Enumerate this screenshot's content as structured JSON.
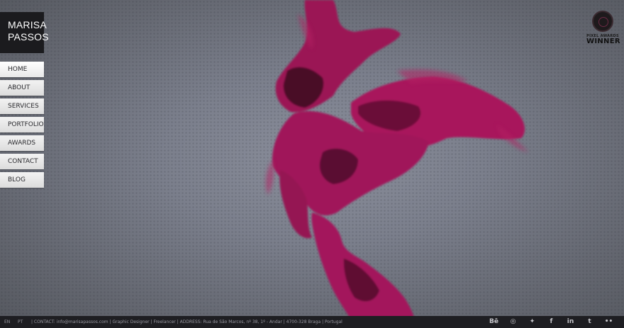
{
  "site": {
    "name_line1": "MARISA",
    "name_line2": "PASSOS"
  },
  "nav": {
    "items": [
      {
        "label": "HOME"
      },
      {
        "label": "ABOUT"
      },
      {
        "label": "SERVICES"
      },
      {
        "label": "PORTFOLIO"
      },
      {
        "label": "AWARDS"
      },
      {
        "label": "CONTACT"
      },
      {
        "label": "BLOG"
      }
    ],
    "active": "HOME"
  },
  "award": {
    "line1": "PIXEL AWARDS",
    "line2": "WINNER"
  },
  "colors": {
    "ink": "#a4165a",
    "background": "#7b7f8c",
    "footer": "#1e1e22"
  },
  "footer": {
    "lang_en": "EN",
    "lang_pt": "PT",
    "info": "| CONTACT: info@marisapassos.com    | Graphic Designer | Freelancer |   ADDRESS: Rua de São Marcos, nº 38, 1º - Andar | 4700-328 Braga | Portugal",
    "social": [
      {
        "icon": "behance-icon",
        "glyph": "Bē"
      },
      {
        "icon": "dribbble-icon",
        "glyph": "◎"
      },
      {
        "icon": "twitter-icon",
        "glyph": "✦"
      },
      {
        "icon": "facebook-icon",
        "glyph": "f"
      },
      {
        "icon": "linkedin-icon",
        "glyph": "in"
      },
      {
        "icon": "tumblr-icon",
        "glyph": "t"
      },
      {
        "icon": "flickr-icon",
        "glyph": "••"
      }
    ]
  }
}
